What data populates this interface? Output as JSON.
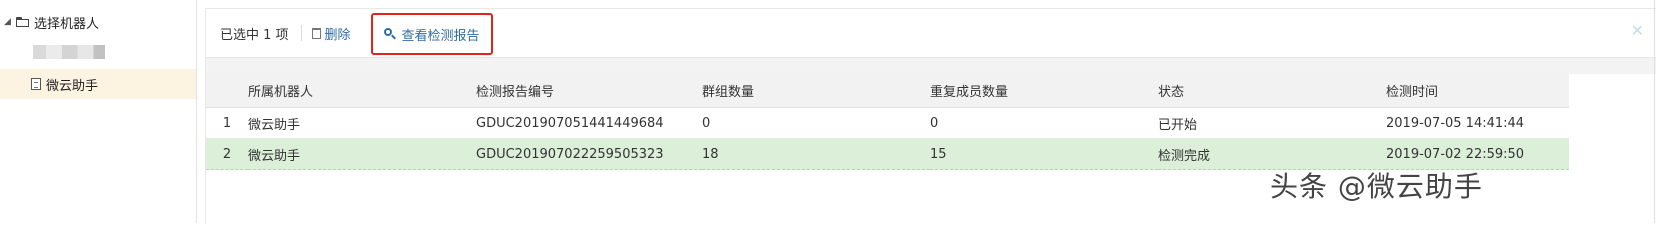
{
  "sidebar": {
    "root_label": "选择机器人",
    "items": [
      {
        "label": "微云助手",
        "active": true
      }
    ]
  },
  "toolbar": {
    "selected_label": "已选中 1 项",
    "delete_label": "删除",
    "view_report_label": "查看检测报告"
  },
  "table": {
    "columns": [
      "",
      "所属机器人",
      "检测报告编号",
      "群组数量",
      "重复成员数量",
      "状态",
      "检测时间"
    ],
    "rows": [
      {
        "index": "1",
        "robot": "微云助手",
        "report_id": "GDUC201907051441449684",
        "groups": "0",
        "duplicates": "0",
        "status": "已开始",
        "time": "2019-07-05 14:41:44",
        "selected": false
      },
      {
        "index": "2",
        "robot": "微云助手",
        "report_id": "GDUC201907022259505323",
        "groups": "18",
        "duplicates": "15",
        "status": "检测完成",
        "time": "2019-07-02 22:59:50",
        "selected": true
      }
    ]
  },
  "watermark": "头条 @微云助手",
  "colors": {
    "accent": "#2e6da4",
    "highlight_border": "#e32322",
    "selected_row": "#dcefd9",
    "active_tree_item": "#fdf3e1"
  },
  "icons": {
    "tree_caret": "caret-down-icon",
    "tree_folder": "folder-open-icon",
    "tree_file": "file-icon",
    "delete": "trash-icon",
    "view_report": "magnifier-icon",
    "close": "close-icon"
  }
}
